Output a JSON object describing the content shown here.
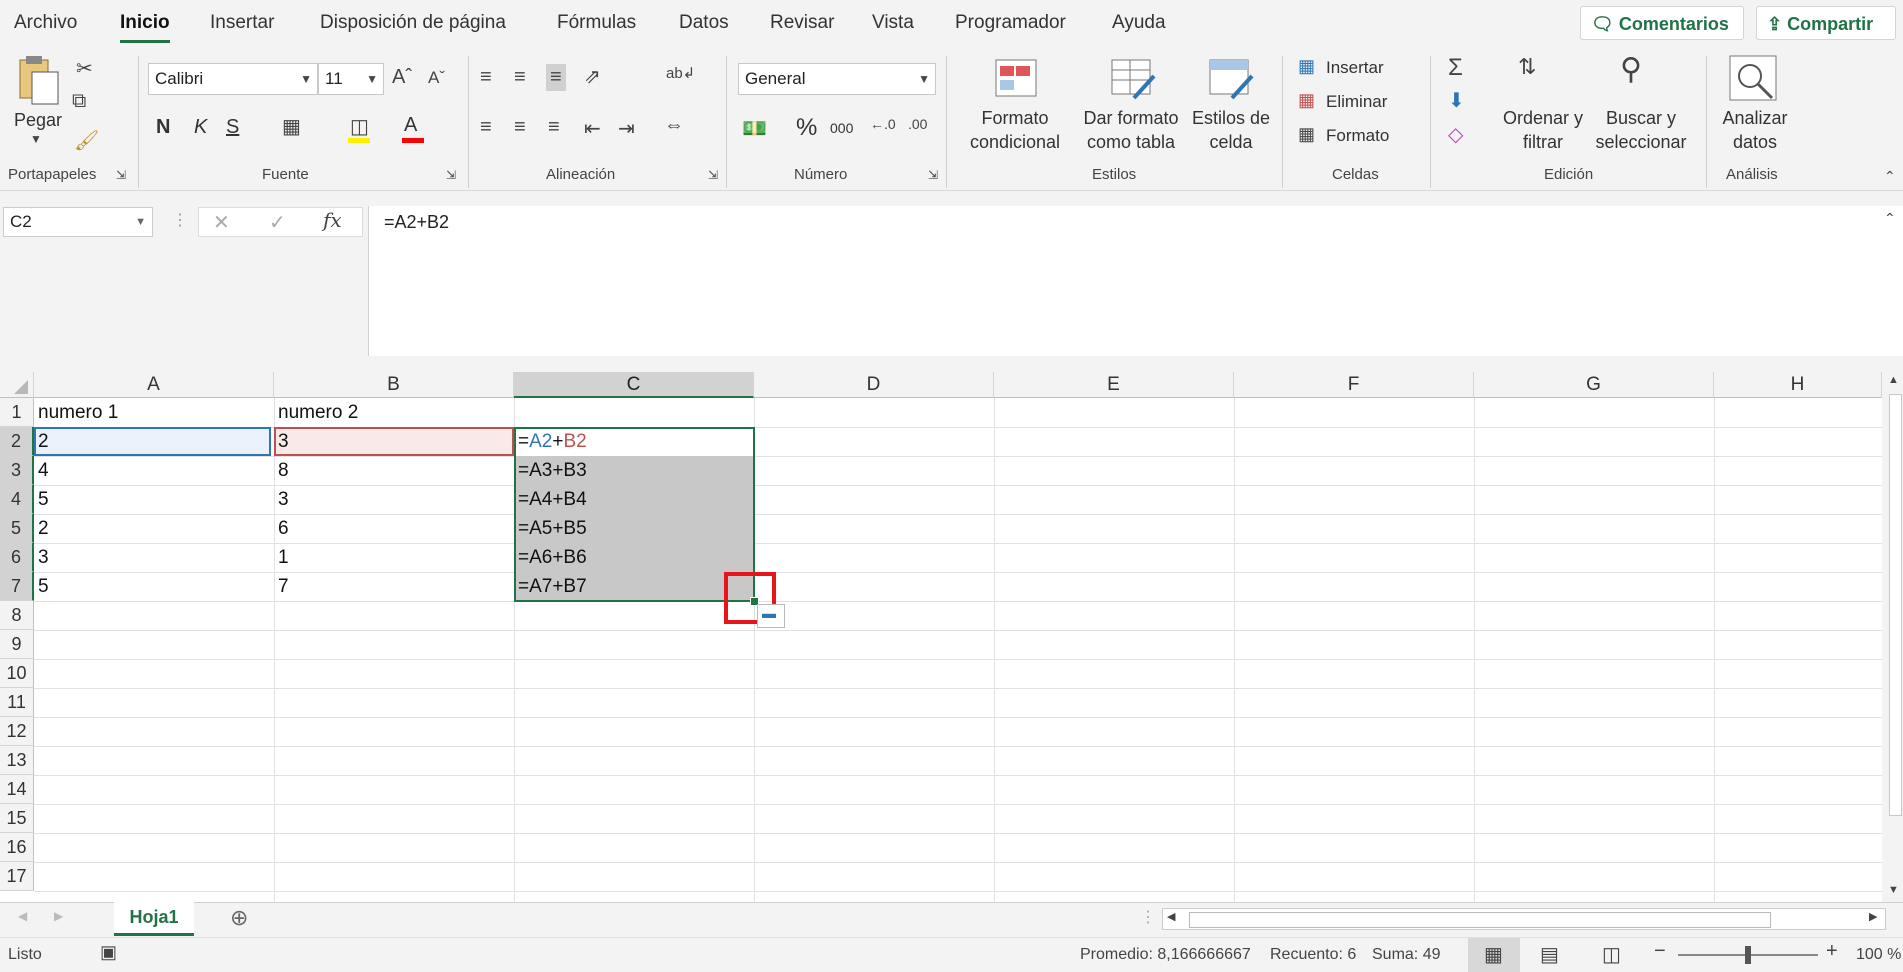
{
  "tabs": [
    "Archivo",
    "Inicio",
    "Insertar",
    "Disposición de página",
    "Fórmulas",
    "Datos",
    "Revisar",
    "Vista",
    "Programador",
    "Ayuda"
  ],
  "top_buttons": {
    "comments": "Comentarios",
    "share": "Compartir"
  },
  "ribbon": {
    "clipboard": {
      "paste": "Pegar",
      "label": "Portapapeles"
    },
    "font": {
      "name": "Calibri",
      "size": "11",
      "bold": "N",
      "italic": "K",
      "underline": "S",
      "label": "Fuente"
    },
    "alignment": {
      "label": "Alineación"
    },
    "number": {
      "format": "General",
      "label": "Número",
      "percent": "%",
      "thousands": "000"
    },
    "styles": {
      "conditional": "Formato\ncondicional",
      "as_table": "Dar formato\ncomo tabla",
      "cell_styles": "Estilos de\ncelda",
      "label": "Estilos"
    },
    "cells": {
      "insert": "Insertar",
      "delete": "Eliminar",
      "format": "Formato",
      "label": "Celdas"
    },
    "editing": {
      "sort": "Ordenar y\nfiltrar",
      "find": "Buscar y\nseleccionar",
      "label": "Edición"
    },
    "analysis": {
      "analyze": "Analizar\ndatos",
      "label": "Análisis"
    }
  },
  "name_box": "C2",
  "formula": "=A2+B2",
  "columns": [
    "A",
    "B",
    "C",
    "D",
    "E",
    "F",
    "G",
    "H"
  ],
  "rows": [
    "1",
    "2",
    "3",
    "4",
    "5",
    "6",
    "7",
    "8",
    "9",
    "10",
    "11",
    "12",
    "13",
    "14",
    "15",
    "16",
    "17"
  ],
  "cells": {
    "A": [
      "numero 1",
      "2",
      "4",
      "5",
      "2",
      "3",
      "5"
    ],
    "B": [
      "numero 2",
      "3",
      "8",
      "3",
      "6",
      "1",
      "7"
    ],
    "C": [
      "",
      "=A2+B2",
      "=A3+B3",
      "=A4+B4",
      "=A5+B5",
      "=A6+B6",
      "=A7+B7"
    ]
  },
  "c2_parts": {
    "eq": "=",
    "a": "A2",
    "plus": "+",
    "b": "B2"
  },
  "sheet_tab": "Hoja1",
  "status": {
    "mode": "Listo",
    "average": "Promedio: 8,166666667",
    "count": "Recuento: 6",
    "sum": "Suma: 49",
    "zoom": "100 %"
  },
  "colors": {
    "accent": "#217346",
    "ref_blue": "#2e75b6",
    "ref_red": "#c0504d"
  }
}
